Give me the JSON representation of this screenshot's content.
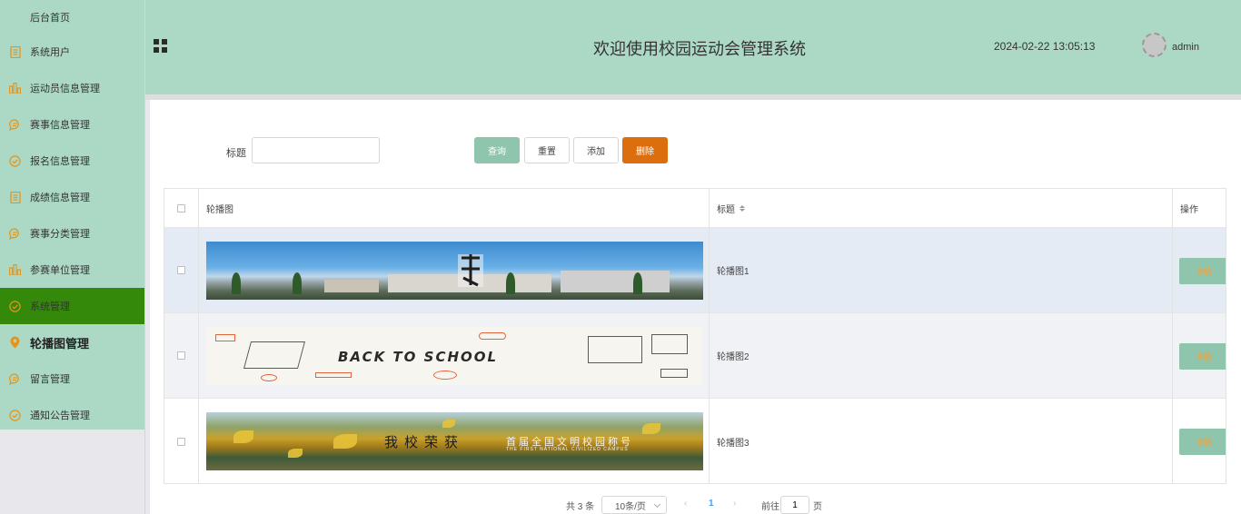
{
  "sidebar": {
    "home": "后台首页",
    "items": [
      {
        "label": "系统用户",
        "icon": "document-icon"
      },
      {
        "label": "运动员信息管理",
        "icon": "bar-chart-icon"
      },
      {
        "label": "赛事信息管理",
        "icon": "chat-icon"
      },
      {
        "label": "报名信息管理",
        "icon": "check-circle-icon"
      },
      {
        "label": "成绩信息管理",
        "icon": "document-icon"
      },
      {
        "label": "赛事分类管理",
        "icon": "chat-icon"
      },
      {
        "label": "参赛单位管理",
        "icon": "bar-chart-icon"
      },
      {
        "label": "系统管理",
        "icon": "check-circle-icon"
      },
      {
        "label": "轮播图管理",
        "icon": "location-pin-icon"
      },
      {
        "label": "留言管理",
        "icon": "chat-icon"
      },
      {
        "label": "通知公告管理",
        "icon": "check-circle-icon"
      }
    ],
    "active_color": "#34890a",
    "icon_color": "#e69419"
  },
  "header": {
    "title": "欢迎使用校园运动会管理系统",
    "datetime": "2024-02-22 13:05:13",
    "username": "admin",
    "bg_color": "#acd9c6"
  },
  "search": {
    "label": "标题",
    "value": "",
    "placeholder": "",
    "buttons": {
      "query": "查询",
      "reset": "重置",
      "add": "添加",
      "delete": "删除"
    }
  },
  "table": {
    "columns": {
      "image": "轮播图",
      "title": "标题",
      "ops": "操作"
    },
    "rows": [
      {
        "title": "轮播图1",
        "action": "详情"
      },
      {
        "title": "轮播图2",
        "action": "详情"
      },
      {
        "title": "轮播图3",
        "action": "详情"
      }
    ],
    "banner2_text": "BACK TO SCHOOL",
    "banner3_text": "我校荣获",
    "banner3_subtext": "首届全国文明校园称号",
    "banner3_en": "THE FIRST NATIONAL CIVILIZED CAMPUS"
  },
  "pagination": {
    "total": "共 3 条",
    "page_size": "10条/页",
    "current_page": "1",
    "goto_label": "前往",
    "jump_value": "1",
    "page_unit": "页"
  }
}
